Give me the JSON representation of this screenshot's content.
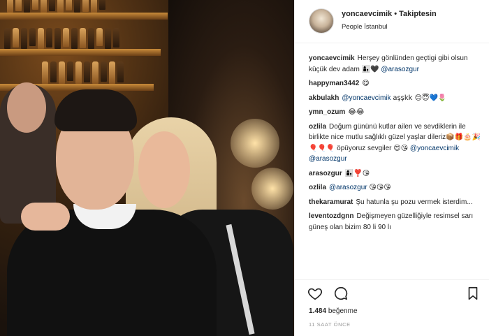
{
  "post": {
    "header": {
      "username": "yoncaevcimik",
      "separator": "•",
      "follow_label": "Takiptesin",
      "location": "People İstanbul"
    },
    "comments": [
      {
        "user": "yoncaevcimik",
        "text": "Herşey gönlünden geçtigi gibi olsun küçük dev adam",
        "emoji": "👩‍👦🖤",
        "mention": "@arasozgur",
        "after": ""
      },
      {
        "user": "happyman3442",
        "text": "",
        "emoji": "😋",
        "mention": "",
        "after": ""
      },
      {
        "user": "akbulakh",
        "text": "",
        "emoji": "",
        "mention": "@yoncaevcimik",
        "after": "aşşkk 😊😇💙🌷"
      },
      {
        "user": "ymn_ozum",
        "text": "",
        "emoji": "😂😂",
        "mention": "",
        "after": ""
      },
      {
        "user": "ozlila",
        "text": "Doğum gününü kutlar ailen ve sevdiklerin ile birlikte nice mutlu sağlıklı güzel yaşlar dileriz📦🎁🎂🎉🎈🎈🎈 öpüyoruz sevgiler 😍😘",
        "emoji": "",
        "mention": "@yoncaevcimik @arasozgur",
        "after": ""
      },
      {
        "user": "arasozgur",
        "text": "",
        "emoji": "👩‍👦❣️😘",
        "mention": "",
        "after": ""
      },
      {
        "user": "ozlila",
        "text": "",
        "emoji": "",
        "mention": "@arasozgur",
        "after": "😘😘😘"
      },
      {
        "user": "thekaramurat",
        "text": "Şu hatunla şu pozu vermek isterdim...",
        "emoji": "",
        "mention": "",
        "after": ""
      },
      {
        "user": "leventozdgnn",
        "text": "Değişmeyen güzelliğiyle resimsel sarı güneş olan bizim 80 li 90 lı",
        "emoji": "",
        "mention": "",
        "after": ""
      }
    ],
    "actions": {
      "like_icon": "heart-icon",
      "comment_icon": "comment-bubble-icon",
      "save_icon": "bookmark-icon"
    },
    "likes_count": "1.484",
    "likes_label": "beğenme",
    "timestamp": "11 SAAT ÖNCE"
  },
  "colors": {
    "text": "#262626",
    "mention": "#003569",
    "muted": "#999999",
    "border": "#efefef"
  }
}
